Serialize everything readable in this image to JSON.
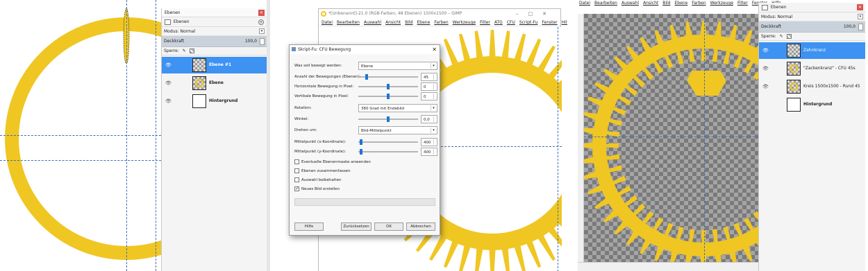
{
  "panel1": {
    "dock": {
      "title": "Ebenen",
      "tab_label": "Ebenen",
      "mode_label": "Modus: Normal",
      "opacity_label": "Deckkraft",
      "opacity_value": "100,0",
      "lock_label": "Sperre:",
      "layers": [
        {
          "name": "Ebene #1",
          "selected": true,
          "thumb": "checker"
        },
        {
          "name": "Ebene",
          "selected": false,
          "thumb": "ring"
        },
        {
          "name": "Hintergrund",
          "selected": false,
          "thumb": "white"
        }
      ]
    }
  },
  "panel2": {
    "window_title": "*[Unbenannt]-21.0 (RGB-Farben, 48 Ebenen) 1500x1500 – GIMP",
    "menu": [
      "Datei",
      "Bearbeiten",
      "Auswahl",
      "Ansicht",
      "Bild",
      "Ebene",
      "Farben",
      "Werkzeuge",
      "Filter",
      "ATG",
      "CFU",
      "Script-Fu",
      "Fenster",
      "Hilfe"
    ],
    "dialog": {
      "title": "Skript-Fu: CFU Bewegung",
      "fields": {
        "was_label": "Was soll bewegt werden:",
        "was_value": "Ebene",
        "anzahl_label": "Anzahl der Bewegungen (Ebenen):",
        "anzahl_value": "45",
        "hbew_label": "Horizontale Bewegung in Pixel:",
        "hbew_value": "0",
        "vbew_label": "Vertikale Bewegung in Pixel:",
        "vbew_value": "0",
        "rotation_label": "Rotation:",
        "rotation_value": "360 Grad mit Endebild",
        "winkel_label": "Winkel:",
        "winkel_value": "0,0",
        "drehen_label": "Drehen um:",
        "drehen_value": "Bild-Mittelpunkt",
        "mx_label": "Mittelpunkt (x-Koordinate):",
        "mx_value": "400",
        "my_label": "Mittelpunkt (y-Koordinate):",
        "my_value": "400"
      },
      "checkboxes": [
        {
          "label": "Eventuelle Ebenenmaske anwenden",
          "checked": false
        },
        {
          "label": "Ebenen zusammenfassen",
          "checked": false
        },
        {
          "label": "Auswahl beibehalten",
          "checked": false
        },
        {
          "label": "Neues Bild erstellen",
          "checked": true
        }
      ],
      "buttons": {
        "help": "Hilfe",
        "reset": "Zurücksetzen",
        "ok": "OK",
        "cancel": "Abbrechen"
      }
    }
  },
  "panel3": {
    "menu": [
      "Datei",
      "Bearbeiten",
      "Auswahl",
      "Ansicht",
      "Bild",
      "Ebene",
      "Farben",
      "Werkzeuge",
      "Filter",
      "Fenster",
      "Hilfe"
    ],
    "dock": {
      "tab_label": "Ebenen",
      "mode_label": "Modus: Normal",
      "opacity_label": "Deckkraft",
      "opacity_value": "100,0",
      "lock_label": "Sperre:",
      "layers": [
        {
          "name": "Zahnkranz",
          "selected": true,
          "thumb": "checker"
        },
        {
          "name": "\"Zackenkranz\" - CFU 45s",
          "selected": false,
          "thumb": "ring"
        },
        {
          "name": "Kreis 1500x1500 - Rund 45",
          "selected": false,
          "thumb": "ring"
        },
        {
          "name": "Hintergrund",
          "selected": false,
          "thumb": "white"
        }
      ]
    }
  },
  "colors": {
    "accent_yellow": "#f0c623",
    "selection_blue": "#3d92f2",
    "checker_dark": "#7a7a7a",
    "checker_light": "#a5a5a5"
  }
}
